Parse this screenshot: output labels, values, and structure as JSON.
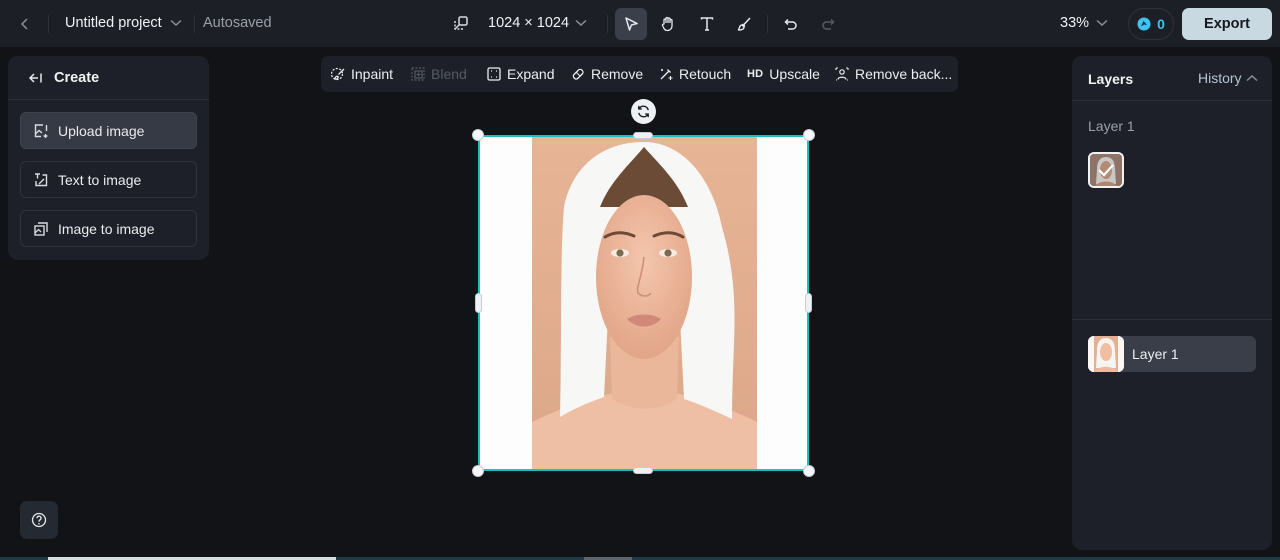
{
  "topbar": {
    "project_title": "Untitled project",
    "save_status": "Autosaved",
    "canvas_size": "1024 × 1024",
    "zoom_level": "33%",
    "credits": "0",
    "export_label": "Export",
    "tools": [
      {
        "name": "select",
        "icon": "pointer-icon",
        "active": true
      },
      {
        "name": "hand",
        "icon": "hand-icon",
        "active": false
      },
      {
        "name": "text",
        "icon": "text-icon",
        "active": false
      },
      {
        "name": "brush",
        "icon": "brush-icon",
        "active": false
      },
      {
        "name": "undo",
        "icon": "undo-icon",
        "active": false
      },
      {
        "name": "redo",
        "icon": "redo-icon",
        "disabled": true
      }
    ]
  },
  "left_panel": {
    "title": "Create",
    "items": [
      {
        "label": "Upload image",
        "icon": "upload-image-icon",
        "active": true
      },
      {
        "label": "Text to image",
        "icon": "text-to-image-icon",
        "active": false
      },
      {
        "label": "Image to image",
        "icon": "image-to-image-icon",
        "active": false
      }
    ]
  },
  "edit_toolbar": {
    "items": [
      {
        "label": "Inpaint",
        "icon": "inpaint-icon",
        "disabled": false
      },
      {
        "label": "Blend",
        "icon": "blend-icon",
        "disabled": true
      },
      {
        "label": "Expand",
        "icon": "expand-icon",
        "disabled": false
      },
      {
        "label": "Remove",
        "icon": "eraser-icon",
        "disabled": false
      },
      {
        "label": "Retouch",
        "icon": "retouch-wand-icon",
        "disabled": false
      },
      {
        "label": "Upscale",
        "icon": "hd-icon",
        "glyph": "HD",
        "disabled": false
      },
      {
        "label": "Remove back...",
        "icon": "remove-background-icon",
        "disabled": false
      }
    ]
  },
  "right_panel": {
    "tab_layers": "Layers",
    "tab_history": "History",
    "group_label": "Layer 1",
    "layers": [
      {
        "name": "Layer 1",
        "selected": true
      }
    ]
  },
  "colors": {
    "accent_selection": "#17c1c0",
    "export_bg": "#c9d9e2",
    "credits_accent": "#3ec3f2",
    "background": "#121317",
    "panel": "#1d2028"
  }
}
